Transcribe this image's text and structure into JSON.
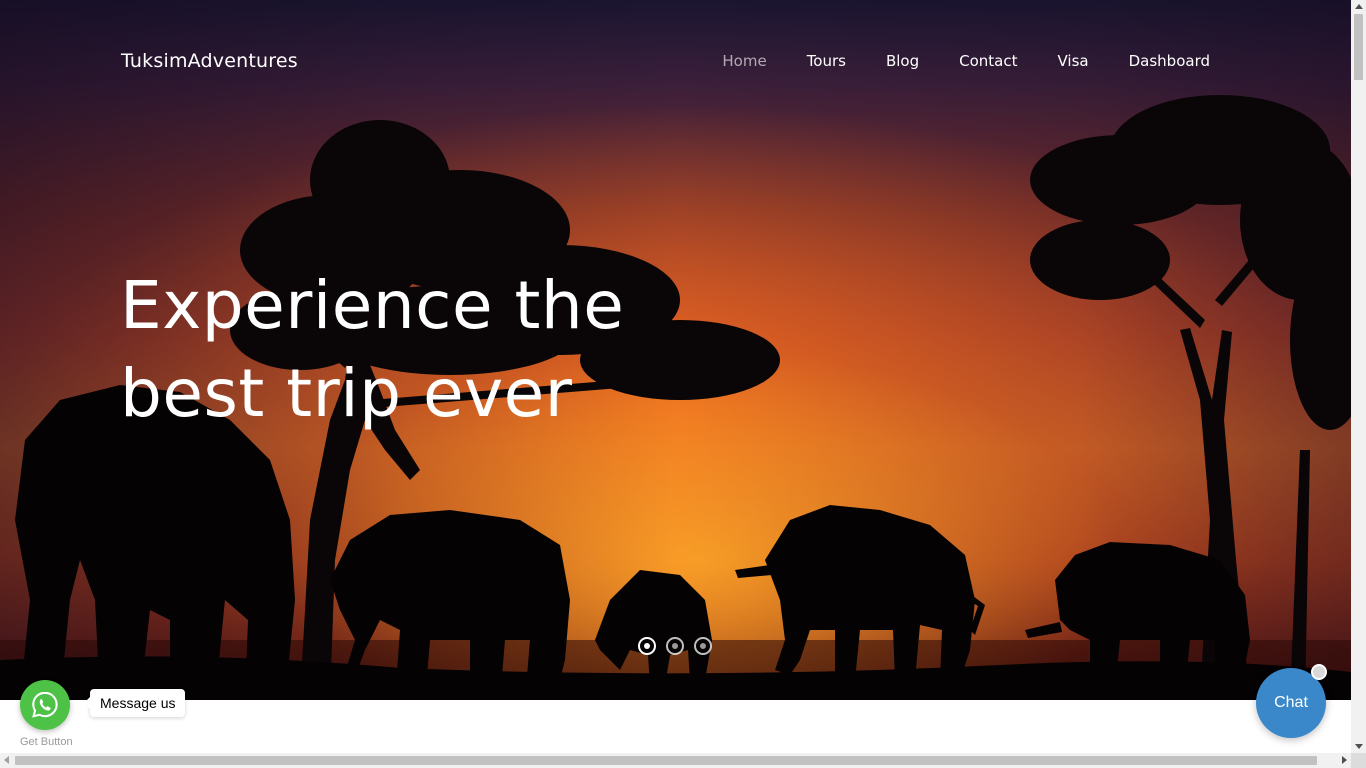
{
  "header": {
    "brand": "TuksimAdventures",
    "nav": [
      {
        "label": "Home",
        "active": true
      },
      {
        "label": "Tours",
        "active": false
      },
      {
        "label": "Blog",
        "active": false
      },
      {
        "label": "Contact",
        "active": false
      },
      {
        "label": "Visa",
        "active": false
      },
      {
        "label": "Dashboard",
        "active": false
      }
    ]
  },
  "hero": {
    "headline_line1": "Experience the",
    "headline_line2": "best trip ever",
    "slider": {
      "count": 3,
      "active_index": 0
    },
    "image_description_icon": "safari-sunset-elephants-image"
  },
  "whatsapp": {
    "message_label": "Message us",
    "footer_label": "Get Button",
    "icon": "whatsapp-icon",
    "color": "#4dc247"
  },
  "chat": {
    "label": "Chat",
    "color": "#3a87c9"
  }
}
